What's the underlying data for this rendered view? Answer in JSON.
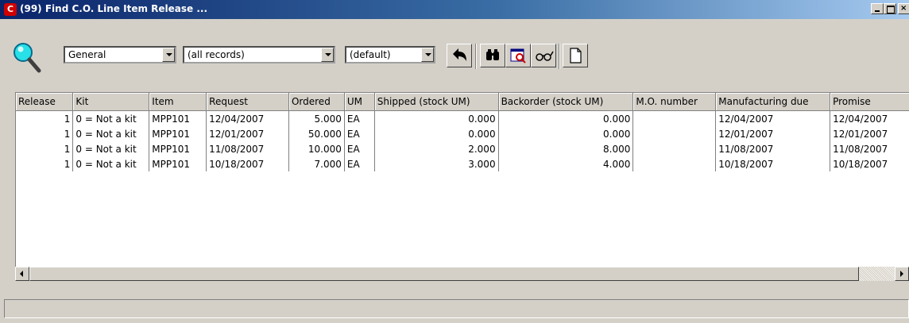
{
  "window": {
    "title": "(99) Find C.O. Line Item Release ..."
  },
  "toolbar": {
    "view_value": "General",
    "filter_value": "(all records)",
    "sort_value": "(default)",
    "buttons": [
      "undo-icon",
      "find-binoculars-icon",
      "query-icon",
      "glasses-icon",
      "new-document-icon"
    ]
  },
  "grid": {
    "columns": [
      "Release",
      "Kit",
      "Item",
      "Request",
      "Ordered",
      "UM",
      "Shipped (stock UM)",
      "Backorder (stock UM)",
      "M.O. number",
      "Manufacturing due",
      "Promise"
    ],
    "rows": [
      [
        "1",
        "0 = Not a kit",
        "MPP101",
        "12/04/2007",
        "5.000",
        "EA",
        "0.000",
        "0.000",
        "",
        "12/04/2007",
        "12/04/2007"
      ],
      [
        "1",
        "0 = Not a kit",
        "MPP101",
        "12/01/2007",
        "50.000",
        "EA",
        "0.000",
        "0.000",
        "",
        "12/01/2007",
        "12/01/2007"
      ],
      [
        "1",
        "0 = Not a kit",
        "MPP101",
        "11/08/2007",
        "10.000",
        "EA",
        "2.000",
        "8.000",
        "",
        "11/08/2007",
        "11/08/2007"
      ],
      [
        "1",
        "0 = Not a kit",
        "MPP101",
        "10/18/2007",
        "7.000",
        "EA",
        "3.000",
        "4.000",
        "",
        "10/18/2007",
        "10/18/2007"
      ]
    ]
  },
  "colors": {
    "titlebar_start": "#0a246a",
    "titlebar_end": "#a6caf0",
    "face": "#d4d0c8",
    "icon_red": "#d00000"
  }
}
